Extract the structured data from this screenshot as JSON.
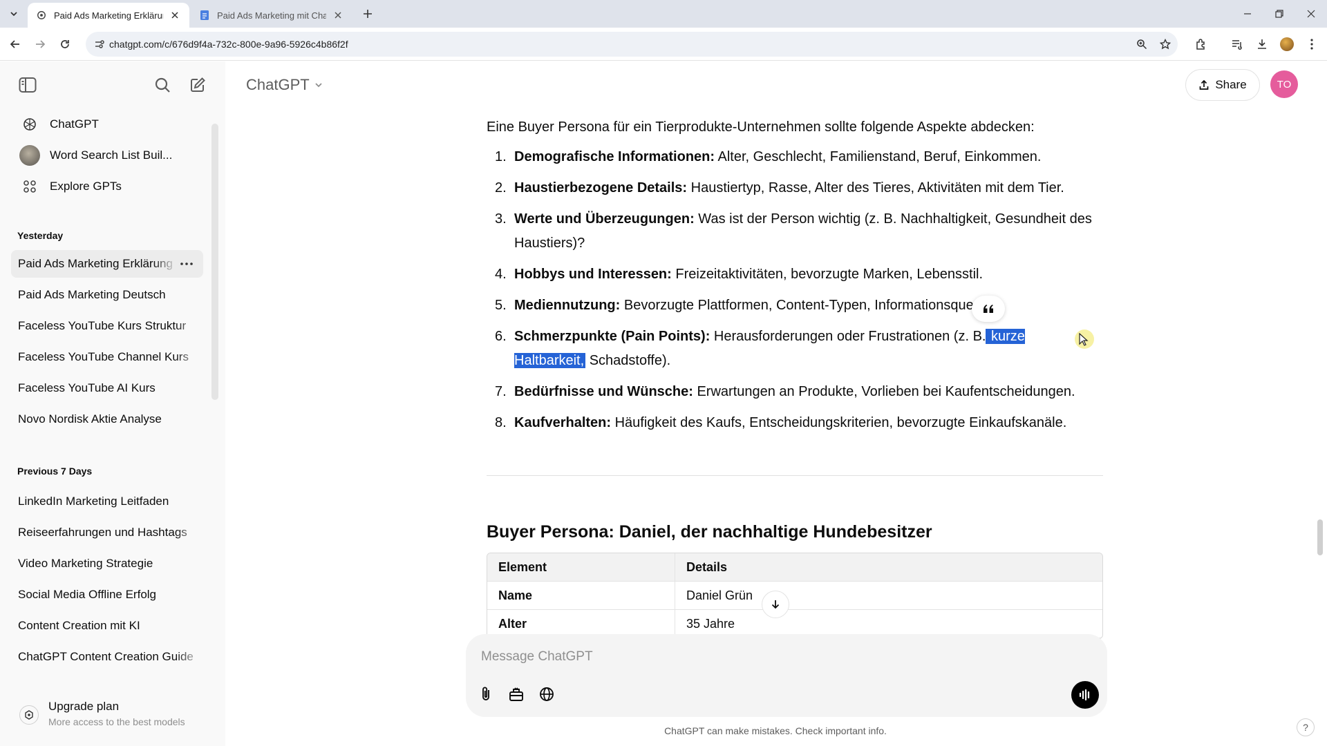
{
  "browser": {
    "tabs": [
      {
        "title": "Paid Ads Marketing Erklärung",
        "active": true
      },
      {
        "title": "Paid Ads Marketing mit ChatGPT",
        "active": false
      }
    ],
    "url": "chatgpt.com/c/676d9f4a-732c-800e-9a96-5926c4b86f2f"
  },
  "sidebar": {
    "pinned": [
      {
        "label": "ChatGPT",
        "icon": "openai-logo-icon"
      },
      {
        "label": "Word Search List Buil...",
        "icon": "gpt-avatar-icon"
      },
      {
        "label": "Explore GPTs",
        "icon": "grid-icon"
      }
    ],
    "sections": [
      {
        "heading": "Yesterday",
        "items": [
          "Paid Ads Marketing Erklärung",
          "Paid Ads Marketing Deutsch",
          "Faceless YouTube Kurs Struktur",
          "Faceless YouTube Channel Kurs",
          "Faceless YouTube AI Kurs",
          "Novo Nordisk Aktie Analyse"
        ]
      },
      {
        "heading": "Previous 7 Days",
        "items": [
          "LinkedIn Marketing Leitfaden",
          "Reiseerfahrungen und Hashtags",
          "Video Marketing Strategie",
          "Social Media Offline Erfolg",
          "Content Creation mit KI",
          "ChatGPT Content Creation Guide"
        ]
      }
    ],
    "upgrade": {
      "title": "Upgrade plan",
      "subtitle": "More access to the best models"
    }
  },
  "header": {
    "model": "ChatGPT",
    "share_label": "Share",
    "avatar_initials": "TO",
    "avatar_color": "#e55c9c"
  },
  "message": {
    "intro": "Eine Buyer Persona für ein Tierprodukte-Unternehmen sollte folgende Aspekte abdecken:",
    "list": [
      {
        "num": "1.",
        "bold": "Demografische Informationen:",
        "text": " Alter, Geschlecht, Familienstand, Beruf, Einkommen."
      },
      {
        "num": "2.",
        "bold": "Haustierbezogene Details:",
        "text": " Haustiertyp, Rasse, Alter des Tieres, Aktivitäten mit dem Tier."
      },
      {
        "num": "3.",
        "bold": "Werte und Überzeugungen:",
        "text": " Was ist der Person wichtig (z. B. Nachhaltigkeit, Gesundheit des Haustiers)?"
      },
      {
        "num": "4.",
        "bold": "Hobbys und Interessen:",
        "text": " Freizeitaktivitäten, bevorzugte Marken, Lebensstil."
      },
      {
        "num": "5.",
        "bold": "Mediennutzung:",
        "text": " Bevorzugte Plattformen, Content-Typen, Informationsque"
      },
      {
        "num": "6.",
        "bold": "Schmerzpunkte (Pain Points):",
        "text": " Herausforderungen oder Frustrationen (z. B.",
        "highlight": " kurze Haltbarkeit,",
        "text2": " Schadstoffe)."
      },
      {
        "num": "7.",
        "bold": "Bedürfnisse und Wünsche:",
        "text": " Erwartungen an Produkte, Vorlieben bei Kaufentscheidungen."
      },
      {
        "num": "8.",
        "bold": "Kaufverhalten:",
        "text": " Häufigkeit des Kaufs, Entscheidungskriterien, bevorzugte Einkaufskanäle."
      }
    ],
    "persona_heading": "Buyer Persona: Daniel, der nachhaltige Hundebesitzer",
    "table": {
      "headers": [
        "Element",
        "Details"
      ],
      "rows": [
        [
          "Name",
          "Daniel Grün"
        ],
        [
          "Alter",
          "35 Jahre"
        ]
      ]
    }
  },
  "composer": {
    "placeholder": "Message ChatGPT",
    "disclaimer": "ChatGPT can make mistakes. Check important info.",
    "help": "?"
  },
  "colors": {
    "selection": "#2563d6",
    "sidebar_bg": "#f9f9f9",
    "active_item_bg": "#ececec"
  }
}
